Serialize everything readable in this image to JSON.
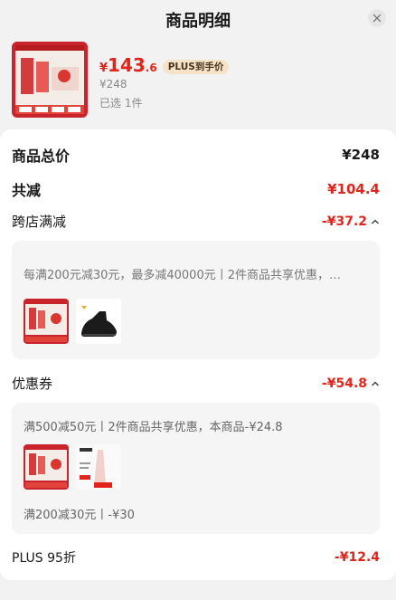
{
  "header": {
    "title": "商品明细",
    "close_icon": "close-icon"
  },
  "product": {
    "currency": "¥",
    "price_int": "143",
    "price_dec": ".6",
    "plus_badge": "PLUS到手价",
    "orig_price": "¥248",
    "selected": "已选 1件"
  },
  "summary": {
    "total_label": "商品总价",
    "total_value": "¥248",
    "discount_label": "共减",
    "discount_value": "¥104.4"
  },
  "cross_store": {
    "label": "跨店满减",
    "value": "-¥37.2",
    "detail": "每满200元减30元，最多减40000元丨2件商品共享优惠，…"
  },
  "coupon": {
    "label": "优惠券",
    "value": "-¥54.8",
    "detail1": "满500减50元丨2件商品共享优惠，本商品-¥24.8",
    "detail2": "满200减30元丨-¥30"
  },
  "plus": {
    "label": "PLUS 95折",
    "value": "-¥12.4"
  },
  "colors": {
    "accent_red": "#e1251b",
    "plus_gold": "#f6e3c7"
  }
}
